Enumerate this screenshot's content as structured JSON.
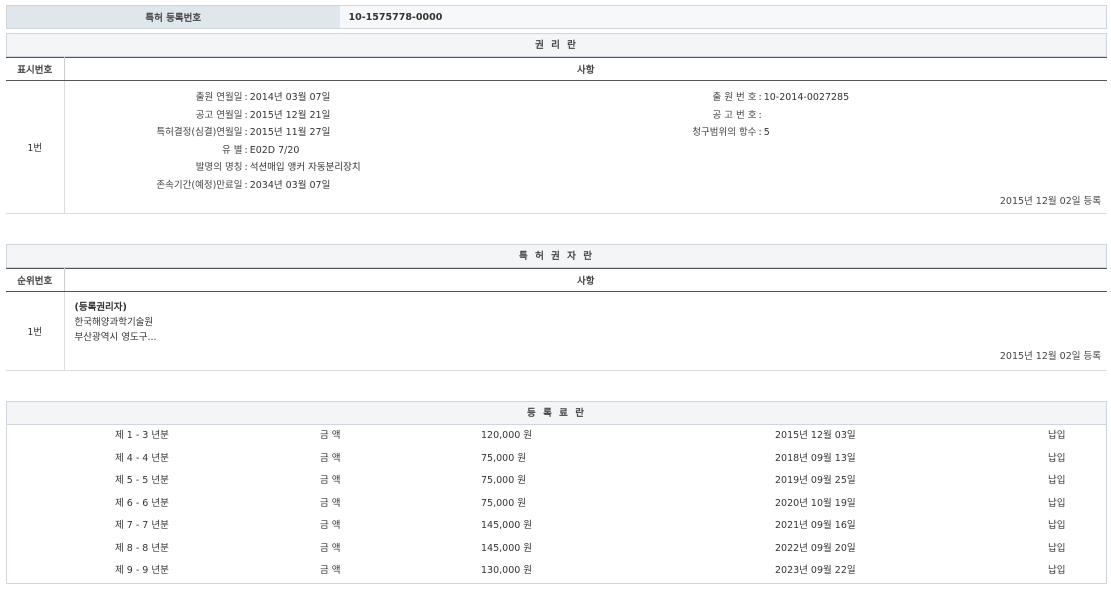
{
  "registration": {
    "label": "특허 등록번호",
    "value": "10-1575778-0000"
  },
  "rights": {
    "title": "권 리 란",
    "col_no": "표시번호",
    "col_content": "사항",
    "row_no": "1번",
    "left": [
      {
        "k": "출원 연월일",
        "v": "2014년 03월 07일"
      },
      {
        "k": "공고 연월일",
        "v": "2015년 12월 21일"
      },
      {
        "k": "특허결정(심결)연월일",
        "v": "2015년 11월 27일"
      },
      {
        "k": "유 별",
        "v": "E02D 7/20"
      },
      {
        "k": "발명의 명칭",
        "v": "석션매입 앵커 자동분리장치"
      },
      {
        "k": "존속기간(예정)만료일",
        "v": "2034년 03월 07일"
      }
    ],
    "right": [
      {
        "k": "출 원 번 호",
        "v": "10-2014-0027285"
      },
      {
        "k": "공 고 번 호",
        "v": ""
      },
      {
        "k": "청구범위의 항수",
        "v": "5"
      }
    ],
    "reg_date": "2015년 12월 02일 등록"
  },
  "holders": {
    "title": "특 허 권 자 란",
    "col_no": "순위번호",
    "col_content": "사항",
    "row_no": "1번",
    "type": "(등록권리자)",
    "name": "한국해양과학기술원",
    "address": "부산광역시 영도구...",
    "reg_date": "2015년 12월 02일 등록"
  },
  "fees": {
    "title": "등 록 료 란",
    "amount_label": "금 액",
    "rows": [
      {
        "period": "제 1 - 3 년분",
        "amount": "120,000 원",
        "date": "2015년 12월 03일",
        "status": "납입"
      },
      {
        "period": "제 4 - 4 년분",
        "amount": "75,000 원",
        "date": "2018년 09월 13일",
        "status": "납입"
      },
      {
        "period": "제 5 - 5 년분",
        "amount": "75,000 원",
        "date": "2019년 09월 25일",
        "status": "납입"
      },
      {
        "period": "제 6 - 6 년분",
        "amount": "75,000 원",
        "date": "2020년 10월 19일",
        "status": "납입"
      },
      {
        "period": "제 7 - 7 년분",
        "amount": "145,000 원",
        "date": "2021년 09월 16일",
        "status": "납입"
      },
      {
        "period": "제 8 - 8 년분",
        "amount": "145,000 원",
        "date": "2022년 09월 20일",
        "status": "납입"
      },
      {
        "period": "제 9 - 9 년분",
        "amount": "130,000 원",
        "date": "2023년 09월 22일",
        "status": "납입"
      }
    ]
  }
}
